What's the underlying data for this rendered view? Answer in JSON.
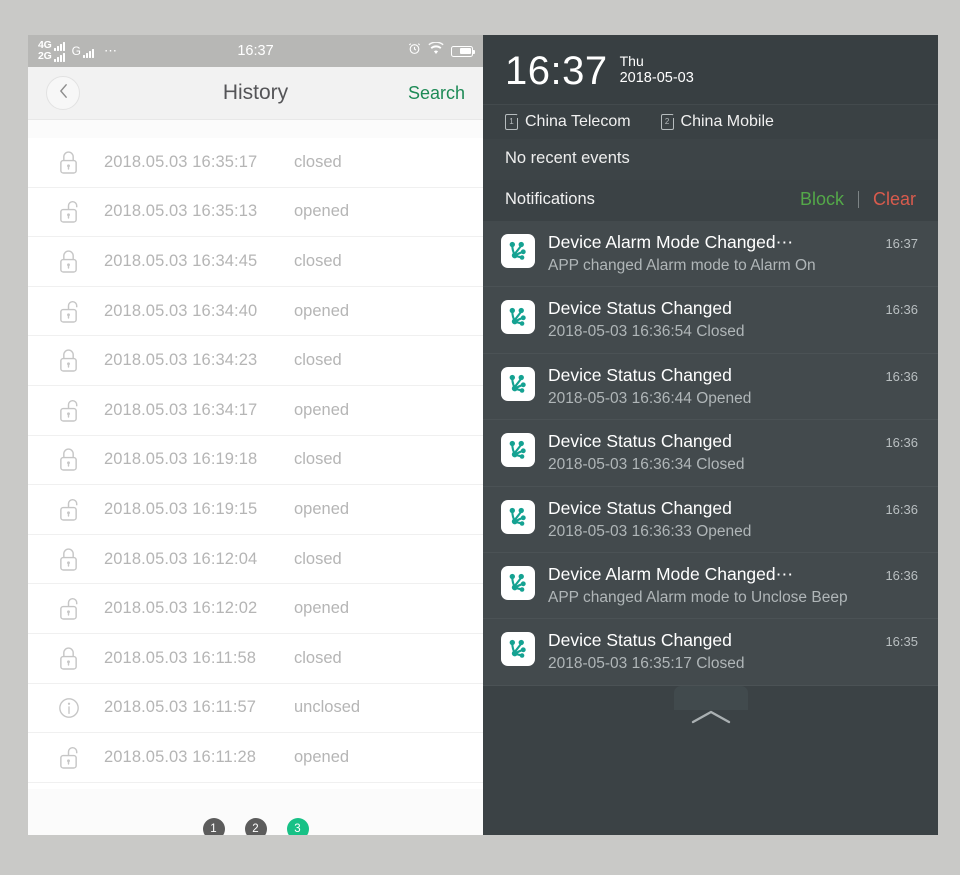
{
  "left_phone": {
    "status_bar": {
      "sim1_label": "4G",
      "sim2_label": "2G",
      "secondary_network": "G",
      "more_dots": "⋯",
      "time": "16:37",
      "icons": [
        "alarm-clock-icon",
        "wifi-icon",
        "battery-icon"
      ]
    },
    "nav": {
      "back_icon": "chevron-left-icon",
      "title": "History",
      "search_label": "Search"
    },
    "history_rows": [
      {
        "icon": "lock-closed-icon",
        "date": "2018.05.03 16:35:17",
        "state": "closed"
      },
      {
        "icon": "lock-open-icon",
        "date": "2018.05.03 16:35:13",
        "state": "opened"
      },
      {
        "icon": "lock-closed-icon",
        "date": "2018.05.03 16:34:45",
        "state": "closed"
      },
      {
        "icon": "lock-open-icon",
        "date": "2018.05.03 16:34:40",
        "state": "opened"
      },
      {
        "icon": "lock-closed-icon",
        "date": "2018.05.03 16:34:23",
        "state": "closed"
      },
      {
        "icon": "lock-open-icon",
        "date": "2018.05.03 16:34:17",
        "state": "opened"
      },
      {
        "icon": "lock-closed-icon",
        "date": "2018.05.03 16:19:18",
        "state": "closed"
      },
      {
        "icon": "lock-open-icon",
        "date": "2018.05.03 16:19:15",
        "state": "opened"
      },
      {
        "icon": "lock-closed-icon",
        "date": "2018.05.03 16:12:04",
        "state": "closed"
      },
      {
        "icon": "lock-open-icon",
        "date": "2018.05.03 16:12:02",
        "state": "opened"
      },
      {
        "icon": "lock-closed-icon",
        "date": "2018.05.03 16:11:58",
        "state": "closed"
      },
      {
        "icon": "info-circle-icon",
        "date": "2018.05.03 16:11:57",
        "state": "unclosed"
      },
      {
        "icon": "lock-open-icon",
        "date": "2018.05.03 16:11:28",
        "state": "opened"
      }
    ],
    "pagination": {
      "pages": [
        "1",
        "2",
        "3"
      ],
      "active": "3",
      "active_color": "#17c186",
      "inactive_color": "#5c5c5c"
    }
  },
  "right_phone": {
    "clock": {
      "time": "16:37",
      "day_of_week": "Thu",
      "date": "2018-05-03"
    },
    "carriers": [
      {
        "sim": "1",
        "name": "China Telecom"
      },
      {
        "sim": "2",
        "name": "China Mobile"
      }
    ],
    "no_recent_events": "No recent events",
    "notifications_bar": {
      "label": "Notifications",
      "block_label": "Block",
      "clear_label": "Clear",
      "block_color": "#54a849",
      "clear_color": "#d85b4d"
    },
    "notifications": [
      {
        "icon": "app-icon",
        "title": "Device Alarm Mode Changed⋯",
        "subtitle": "APP changed Alarm mode to Alarm On",
        "time": "16:37"
      },
      {
        "icon": "app-icon",
        "title": "Device Status Changed",
        "subtitle": "2018-05-03 16:36:54 Closed",
        "time": "16:36"
      },
      {
        "icon": "app-icon",
        "title": "Device Status Changed",
        "subtitle": "2018-05-03 16:36:44 Opened",
        "time": "16:36"
      },
      {
        "icon": "app-icon",
        "title": "Device Status Changed",
        "subtitle": "2018-05-03 16:36:34 Closed",
        "time": "16:36"
      },
      {
        "icon": "app-icon",
        "title": "Device Status Changed",
        "subtitle": "2018-05-03 16:36:33 Opened",
        "time": "16:36"
      },
      {
        "icon": "app-icon",
        "title": "Device Alarm Mode Changed⋯",
        "subtitle": "APP changed Alarm mode to Unclose Beep",
        "time": "16:36"
      },
      {
        "icon": "app-icon",
        "title": "Device Status Changed",
        "subtitle": "2018-05-03 16:35:17 Closed",
        "time": "16:35"
      }
    ],
    "handle_icon": "chevron-up-icon"
  }
}
